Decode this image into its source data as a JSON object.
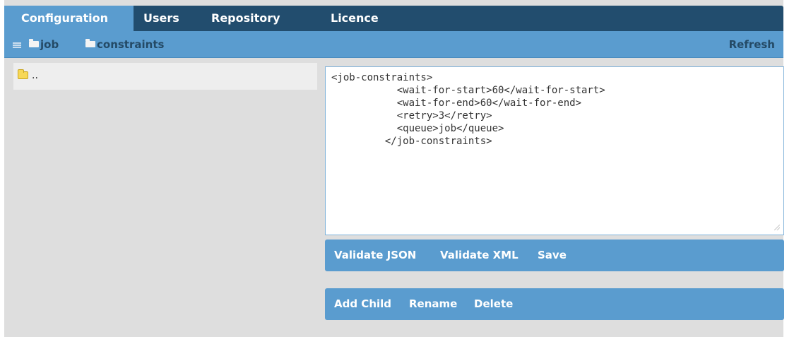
{
  "nav": {
    "tabs": [
      {
        "label": "Configuration",
        "active": true
      },
      {
        "label": "Users",
        "active": false
      },
      {
        "label": "Repository",
        "active": false
      },
      {
        "label": "Licence",
        "active": false
      }
    ]
  },
  "breadcrumb": {
    "menu_icon": "list-icon",
    "items": [
      {
        "label": "job",
        "icon": "folder-icon"
      },
      {
        "label": "constraints",
        "icon": "folder-icon"
      }
    ],
    "refresh_label": "Refresh"
  },
  "tree": {
    "items": [
      {
        "label": "..",
        "icon": "folder-icon"
      }
    ]
  },
  "editor": {
    "content": "<job-constraints>\n           <wait-for-start>60</wait-for-start>\n           <wait-for-end>60</wait-for-end>\n           <retry>3</retry>\n           <queue>job</queue>\n         </job-constraints>"
  },
  "actions_primary": {
    "validate_json": "Validate JSON",
    "validate_xml": "Validate XML",
    "save": "Save"
  },
  "actions_secondary": {
    "add_child": "Add Child",
    "rename": "Rename",
    "delete": "Delete"
  },
  "colors": {
    "nav_bg": "#224d6e",
    "accent": "#5a9ccf",
    "crumb_text": "#244a66",
    "panel_bg": "#dedede",
    "folder_yellow": "#f7d857"
  }
}
